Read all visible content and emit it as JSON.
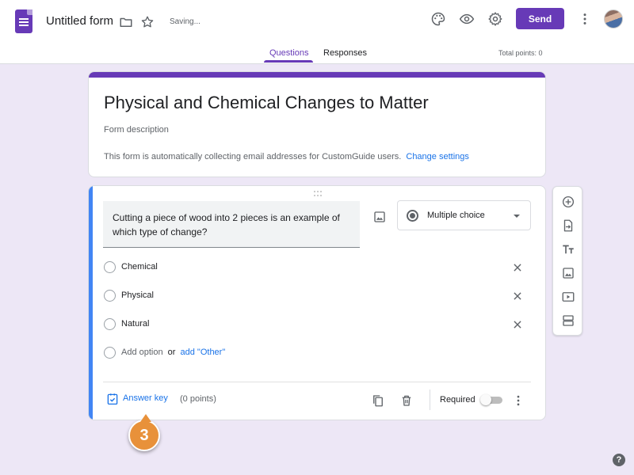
{
  "header": {
    "doc_title": "Untitled form",
    "saving_status": "Saving...",
    "send_label": "Send",
    "tabs": [
      {
        "label": "Questions",
        "active": true
      },
      {
        "label": "Responses",
        "active": false
      }
    ],
    "total_points": "Total points: 0",
    "icons": [
      "forms-app-icon",
      "folder-icon",
      "star-icon",
      "palette-icon",
      "eye-icon",
      "gear-icon",
      "more-vert-icon",
      "avatar"
    ]
  },
  "form": {
    "title": "Physical and Chemical Changes to Matter",
    "description_placeholder": "Form description",
    "collect_note": "This form is automatically collecting email addresses for CustomGuide users.",
    "change_settings": "Change settings"
  },
  "question": {
    "text": "Cutting a piece of wood into 2 pieces is an example of which type of change?",
    "type": "Multiple choice",
    "options": [
      "Chemical",
      "Physical",
      "Natural"
    ],
    "add_option": "Add option",
    "or": "or",
    "add_other": "add \"Other\"",
    "answer_key": "Answer key",
    "points": "(0 points)",
    "required_label": "Required",
    "required": false
  },
  "callout": {
    "number": "3"
  },
  "colors": {
    "accent": "#673ab7",
    "link": "#1a73e8",
    "active_question_bar": "#4285f4",
    "background": "#ede7f6",
    "callout": "#e8913a"
  }
}
